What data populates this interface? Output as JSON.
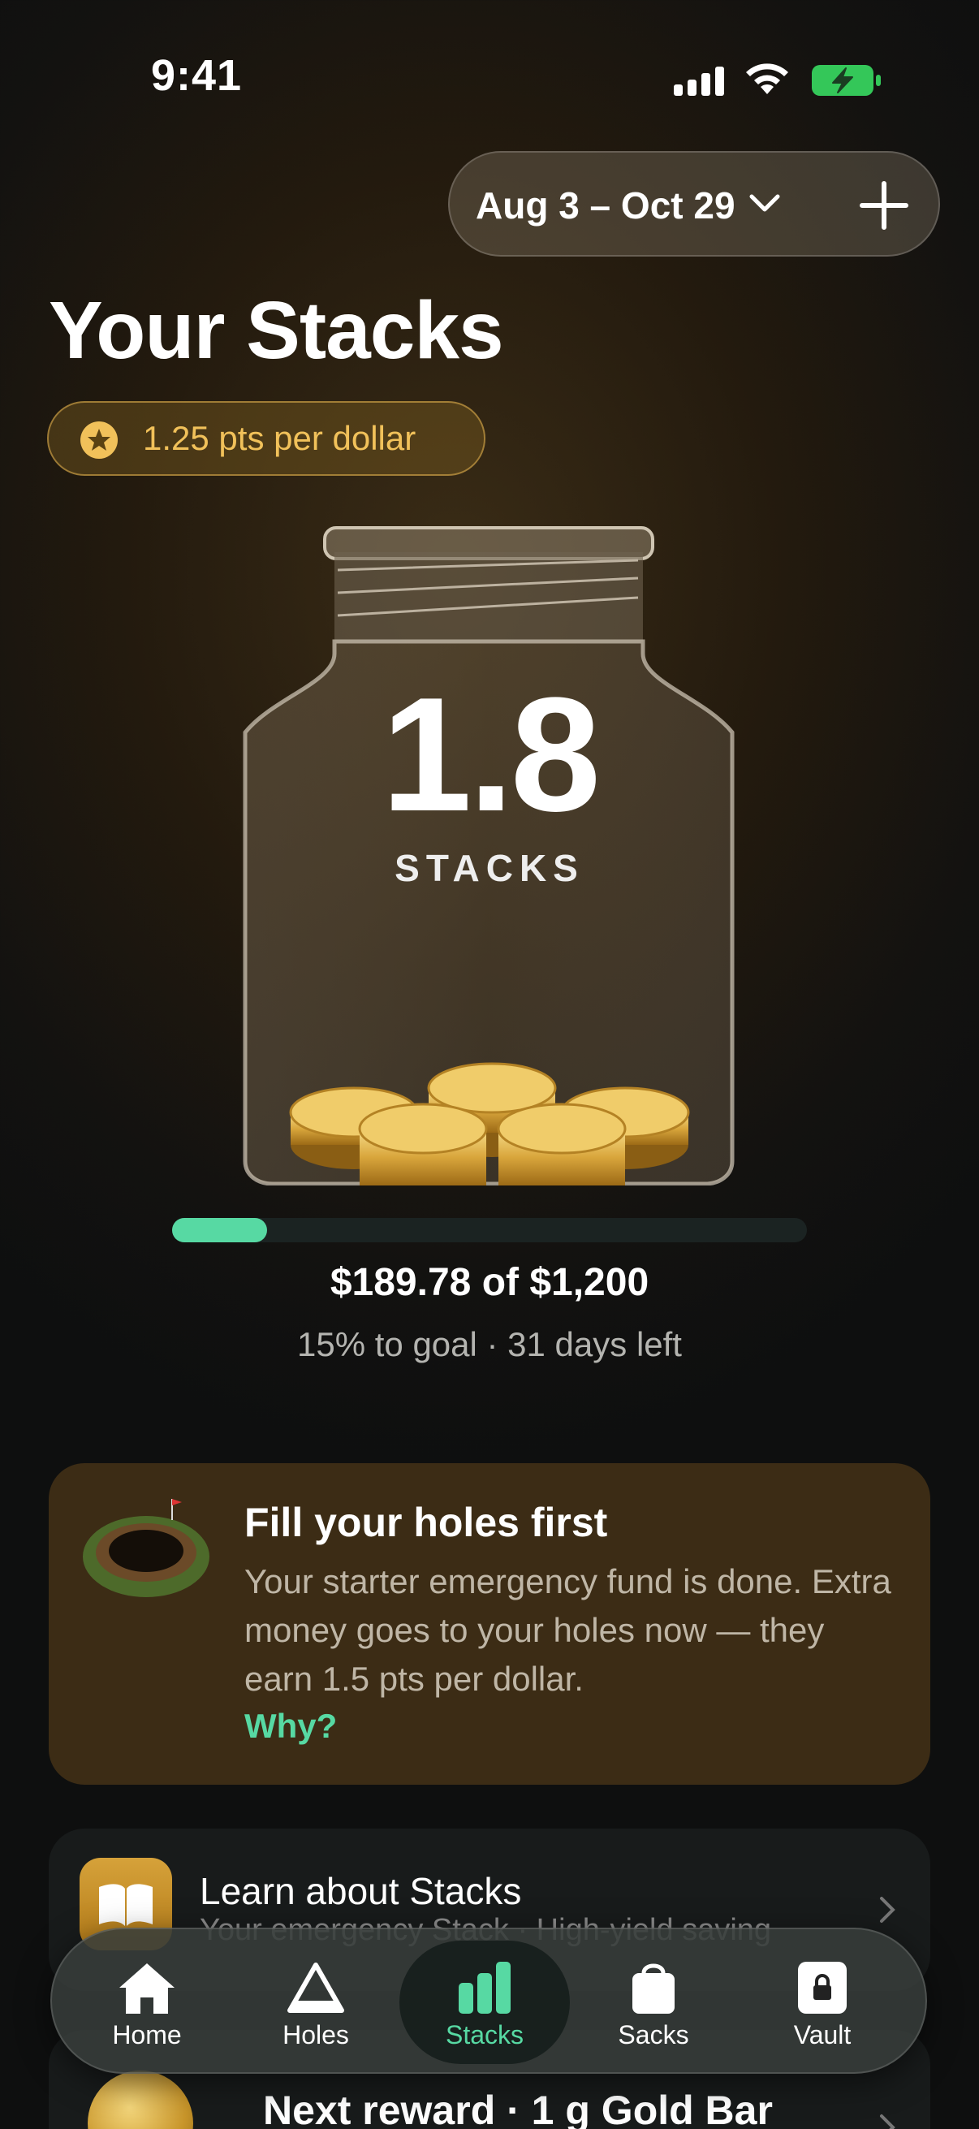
{
  "status_bar": {
    "time": "9:41"
  },
  "header": {
    "date_range": "Aug 3 – Oct 29",
    "title": "Your Stacks",
    "points_rate": "1.25 pts per dollar"
  },
  "jar": {
    "value": "1.8",
    "unit": "STACKS"
  },
  "goal": {
    "progress_fraction": 0.15,
    "amount": "$189.78 of $1,200",
    "subtitle": "15% to goal · 31 days left"
  },
  "info_card": {
    "title": "Fill your holes first",
    "body": "Your starter emergency fund is done. Extra money goes to your holes now — they earn 1.5 pts per dollar.",
    "link": "Why?"
  },
  "learn_card": {
    "title": "Learn about Stacks",
    "subtitle": "Your emergency Stack · High-yield saving"
  },
  "reward_card": {
    "title": "Next reward · 1 g Gold Bar"
  },
  "tabs": [
    {
      "label": "Home",
      "icon": "home-icon",
      "active": false
    },
    {
      "label": "Holes",
      "icon": "holes-icon",
      "active": false
    },
    {
      "label": "Stacks",
      "icon": "stacks-icon",
      "active": true
    },
    {
      "label": "Sacks",
      "icon": "sacks-icon",
      "active": false
    },
    {
      "label": "Vault",
      "icon": "vault-icon",
      "active": false
    }
  ],
  "colors": {
    "accent": "#57d9a3",
    "gold": "#f1c15a",
    "card_brown": "#3c2c15",
    "battery_green": "#34c759"
  }
}
